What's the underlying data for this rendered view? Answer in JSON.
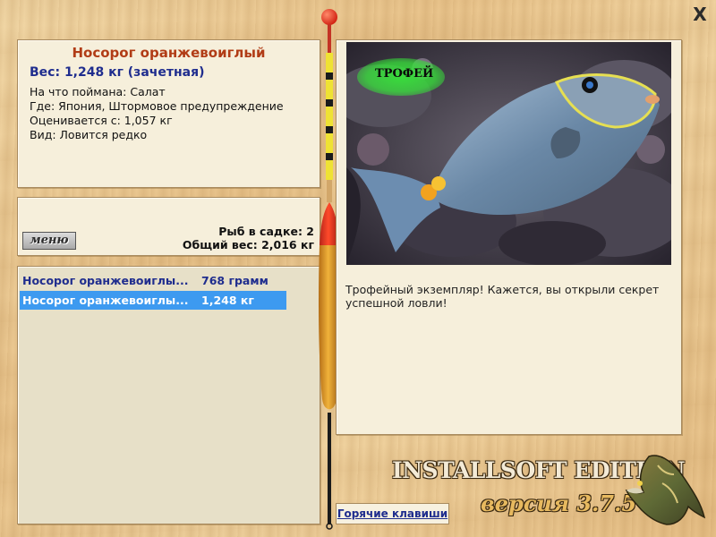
{
  "info": {
    "title": "Носорог оранжевоиглый",
    "weight_line": "Вес: 1,248 кг (зачетная)",
    "lines": [
      "На что поймана: Салат",
      "Где: Япония, Штормовое предупреждение",
      "Оценивается с: 1,057 кг",
      "Вид: Ловится редко"
    ]
  },
  "catch": {
    "menu_label": "меню",
    "fish_count": "Рыб в садке: 2",
    "total_weight": "Общий вес: 2,016 кг"
  },
  "fish_list": [
    {
      "name": "Носорог оранжевоиглы...",
      "weight": "768 грамм",
      "selected": false
    },
    {
      "name": "Носорог оранжевоиглы...",
      "weight": "1,248 кг",
      "selected": true
    }
  ],
  "photo": {
    "badge": "ТРОФЕЙ",
    "description": "Трофейный экземпляр! Кажется, вы открыли секрет успешной ловли!"
  },
  "footer": {
    "hotkeys_label": "Горячие клавиши",
    "edition": "INSTALLSOFT EDITION",
    "version": "версия 3.7.5"
  },
  "window": {
    "close_glyph": "X"
  },
  "colors": {
    "title_red": "#b13c16",
    "link_blue": "#1f2d8e",
    "selection_blue": "#3d9af0",
    "badge_green": "#37e43a"
  }
}
